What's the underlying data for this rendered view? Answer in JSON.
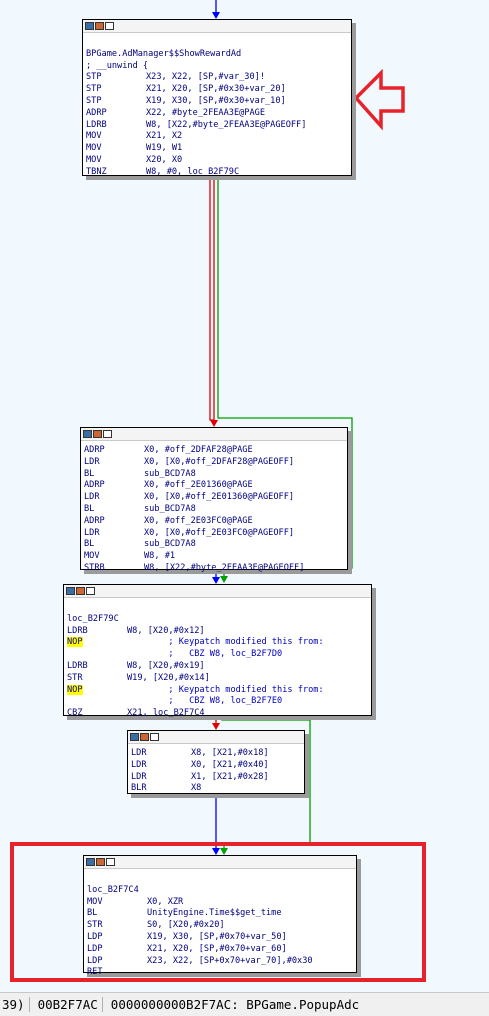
{
  "block1": {
    "lines": [
      {
        "type": "blank"
      },
      {
        "type": "label",
        "text": "BPGame.AdManager$$ShowRewardAd"
      },
      {
        "type": "label",
        "text": "; __unwind {"
      },
      {
        "type": "ins",
        "m": "STP",
        "o": "X23, X22, [SP,#var_30]!"
      },
      {
        "type": "ins",
        "m": "STP",
        "o": "X21, X20, [SP,#0x30+var_20]"
      },
      {
        "type": "ins",
        "m": "STP",
        "o": "X19, X30, [SP,#0x30+var_10]"
      },
      {
        "type": "ins",
        "m": "ADRP",
        "o": "X22, #byte_2FEAA3E@PAGE"
      },
      {
        "type": "ins",
        "m": "LDRB",
        "o": "W8, [X22,#byte_2FEAA3E@PAGEOFF]"
      },
      {
        "type": "ins",
        "m": "MOV",
        "o": "X21, X2"
      },
      {
        "type": "ins",
        "m": "MOV",
        "o": "W19, W1"
      },
      {
        "type": "ins",
        "m": "MOV",
        "o": "X20, X0"
      },
      {
        "type": "ins",
        "m": "TBNZ",
        "o": "W8, #0, loc_B2F79C"
      }
    ]
  },
  "block2": {
    "lines": [
      {
        "type": "ins",
        "m": "ADRP",
        "o": "X0, #off_2DFAF28@PAGE"
      },
      {
        "type": "ins",
        "m": "LDR",
        "o": "X0, [X0,#off_2DFAF28@PAGEOFF]"
      },
      {
        "type": "ins",
        "m": "BL",
        "o": "sub_BCD7A8"
      },
      {
        "type": "ins",
        "m": "ADRP",
        "o": "X0, #off_2E01360@PAGE"
      },
      {
        "type": "ins",
        "m": "LDR",
        "o": "X0, [X0,#off_2E01360@PAGEOFF]"
      },
      {
        "type": "ins",
        "m": "BL",
        "o": "sub_BCD7A8"
      },
      {
        "type": "ins",
        "m": "ADRP",
        "o": "X0, #off_2E03FC0@PAGE"
      },
      {
        "type": "ins",
        "m": "LDR",
        "o": "X0, [X0,#off_2E03FC0@PAGEOFF]"
      },
      {
        "type": "ins",
        "m": "BL",
        "o": "sub_BCD7A8"
      },
      {
        "type": "ins",
        "m": "MOV",
        "o": "W8, #1"
      },
      {
        "type": "ins",
        "m": "STRB",
        "o": "W8, [X22,#byte_2FEAA3E@PAGEOFF]"
      }
    ]
  },
  "block3": {
    "lines": [
      {
        "type": "blank"
      },
      {
        "type": "label",
        "text": "loc_B2F79C"
      },
      {
        "type": "ins",
        "m": "LDRB",
        "o": "W8, [X20,#0x12]"
      },
      {
        "type": "nop",
        "m": "NOP",
        "o": "        ; Keypatch modified this from:"
      },
      {
        "type": "cmt",
        "o": "        ;   CBZ W8, loc_B2F7D0"
      },
      {
        "type": "ins",
        "m": "LDRB",
        "o": "W8, [X20,#0x19]"
      },
      {
        "type": "ins",
        "m": "STR",
        "o": "W19, [X20,#0x14]"
      },
      {
        "type": "nop",
        "m": "NOP",
        "o": "        ; Keypatch modified this from:"
      },
      {
        "type": "cmt",
        "o": "        ;   CBZ W8, loc_B2F7E0"
      },
      {
        "type": "ins",
        "m": "CBZ",
        "o": "X21, loc_B2F7C4"
      }
    ]
  },
  "block4": {
    "lines": [
      {
        "type": "ins",
        "m": "LDR",
        "o": "X8, [X21,#0x18]"
      },
      {
        "type": "ins",
        "m": "LDR",
        "o": "X0, [X21,#0x40]"
      },
      {
        "type": "ins",
        "m": "LDR",
        "o": "X1, [X21,#0x28]"
      },
      {
        "type": "ins",
        "m": "BLR",
        "o": "X8"
      }
    ]
  },
  "block5": {
    "lines": [
      {
        "type": "blank"
      },
      {
        "type": "label",
        "text": "loc_B2F7C4"
      },
      {
        "type": "ins",
        "m": "MOV",
        "o": "X0, XZR"
      },
      {
        "type": "ins",
        "m": "BL",
        "o": "UnityEngine.Time$$get_time"
      },
      {
        "type": "ins",
        "m": "STR",
        "o": "S0, [X20,#0x20]"
      },
      {
        "type": "ins",
        "m": "LDP",
        "o": "X19, X30, [SP,#0x70+var_50]"
      },
      {
        "type": "ins",
        "m": "LDP",
        "o": "X21, X20, [SP,#0x70+var_60]"
      },
      {
        "type": "ins",
        "m": "LDP",
        "o": "X23, X22, [SP+0x70+var_70],#0x30"
      },
      {
        "type": "ins",
        "m": "RET",
        "o": ""
      }
    ]
  },
  "status": {
    "part1": "39)",
    "part2": "00B2F7AC",
    "part3": "0000000000B2F7AC: BPGame.PopupAdc"
  },
  "colors": {
    "background": "#f1f8fe",
    "edge_true": "#00a000",
    "edge_false": "#e00000",
    "edge_uncond": "#0000ff",
    "highlight": "#e8222a"
  }
}
